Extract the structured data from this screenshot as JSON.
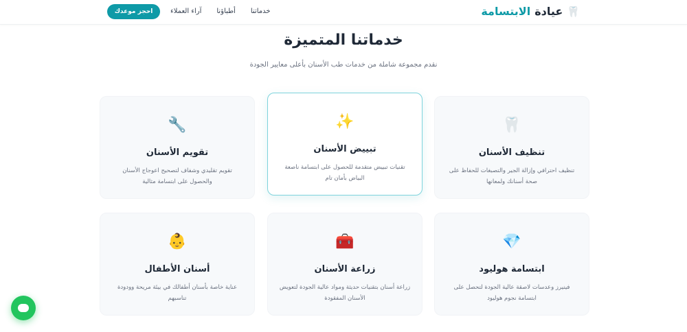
{
  "nav": {
    "brand_part1": "عيادة",
    "brand_part2": "الابتسامة",
    "brand_icon": "tooth-icon",
    "links": [
      "خدماتنا",
      "أطباؤنا",
      "آراء العملاء"
    ],
    "book_button": "احجز موعدك"
  },
  "section": {
    "title": "خدماتنا المتميزة",
    "subtitle": "نقدم مجموعة شاملة من خدمات طب الأسنان بأعلى معايير الجودة"
  },
  "services": [
    {
      "icon": "🔧",
      "icon_name": "wrench-icon",
      "title": "تقويم الأسنان",
      "desc": "تقويم تقليدي وشفاف لتصحيح اعوجاج الأسنان والحصول على ابتسامة مثالية"
    },
    {
      "icon": "✨",
      "icon_name": "sparkles-icon",
      "title": "تبييض الأسنان",
      "desc": "تقنيات تبييض متقدمة للحصول على ابتسامة ناصعة البياض بأمان تام"
    },
    {
      "icon": "🦷",
      "icon_name": "tooth-icon",
      "title": "تنظيف الأسنان",
      "desc": "تنظيف احترافي وإزالة الجير والتصبغات للحفاظ على صحة أسنانك ولمعانها"
    },
    {
      "icon": "👶",
      "icon_name": "baby-icon",
      "title": "أسنان الأطفال",
      "desc": "عناية خاصة بأسنان أطفالك في بيئة مريحة وودودة تناسبهم"
    },
    {
      "icon": "🧰",
      "icon_name": "implant-kit-icon",
      "title": "زراعة الأسنان",
      "desc": "زراعة أسنان بتقنيات حديثة ومواد عالية الجودة لتعويض الأسنان المفقودة"
    },
    {
      "icon": "💎",
      "icon_name": "diamond-icon",
      "title": "ابتسامة هوليود",
      "desc": "فينيرز وعدسات لاصقة عالية الجودة لتحصل على ابتسامة نجوم هوليود"
    }
  ],
  "chat_icon": "chat-bubble-icon",
  "colors": {
    "accent": "#0e9aa7",
    "chat": "#22c55e",
    "active_border": "#7dd3dc"
  }
}
